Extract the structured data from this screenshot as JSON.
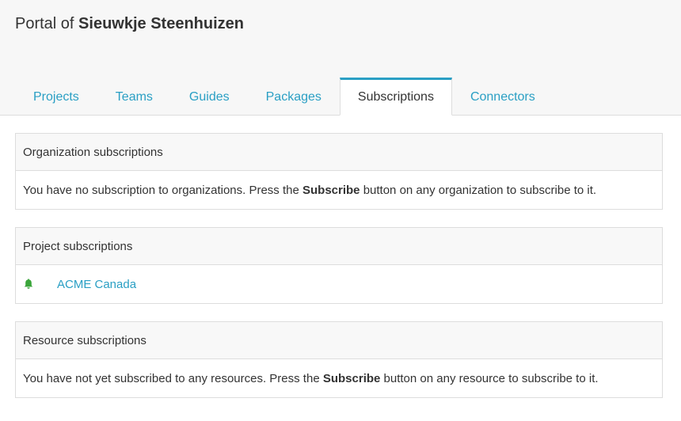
{
  "portal": {
    "prefix": "Portal of",
    "owner": "Sieuwkje Steenhuizen"
  },
  "tabs": [
    {
      "label": "Projects"
    },
    {
      "label": "Teams"
    },
    {
      "label": "Guides"
    },
    {
      "label": "Packages"
    },
    {
      "label": "Subscriptions",
      "active": true
    },
    {
      "label": "Connectors"
    }
  ],
  "organization": {
    "heading": "Organization subscriptions",
    "text_before": "You have no subscription to organizations. Press the ",
    "button_word": "Subscribe",
    "text_after": " button on any organization to subscribe to it."
  },
  "project": {
    "heading": "Project subscriptions",
    "items": [
      {
        "name": "ACME Canada",
        "icon": "bell-icon",
        "icon_color": "#3aa53a"
      }
    ]
  },
  "resource": {
    "heading": "Resource subscriptions",
    "text_before": "You have not yet subscribed to any resources. Press the ",
    "button_word": "Subscribe",
    "text_after": " button on any resource to subscribe to it."
  },
  "colors": {
    "accent": "#2a9fc4",
    "bell": "#3aa53a",
    "border": "#dddddd",
    "header_bg": "#f7f7f7"
  }
}
